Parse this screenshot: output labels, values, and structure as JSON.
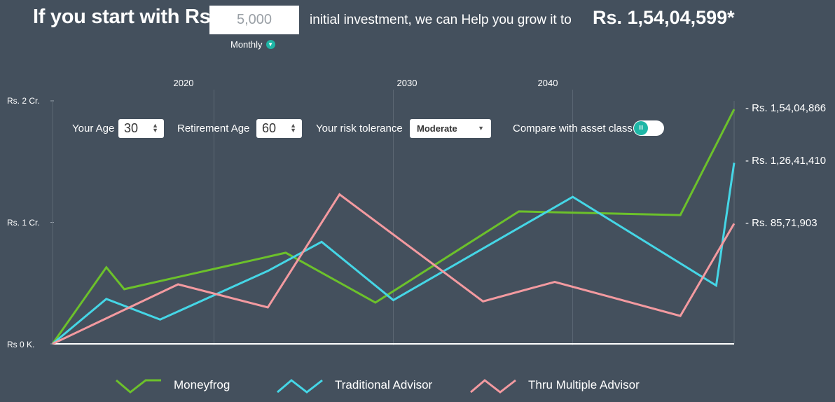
{
  "header": {
    "lead": "If you start with Rs.",
    "amount_value": "5,000",
    "frequency": "Monthly",
    "mid": "initial investment, we can Help you grow it to",
    "result": "Rs. 1,54,04,599*"
  },
  "controls": {
    "age_label": "Your Age",
    "age_value": "30",
    "retirement_label": "Retirement Age",
    "retirement_value": "60",
    "risk_label": "Your risk tolerance",
    "risk_value": "Moderate",
    "compare_label": "Compare with asset class"
  },
  "colors": {
    "background": "#44505d",
    "moneyfrog": "#6cc12b",
    "traditional": "#45d6e6",
    "multiple": "#f39aa0",
    "toggle_accent": "#1fb6a6"
  },
  "chart_data": {
    "type": "line",
    "x_top_ticks": [
      "2020",
      "2030",
      "2040"
    ],
    "y_tick_labels": [
      "Rs. 2 Cr.",
      "Rs. 1 Cr.",
      "Rs 0 K."
    ],
    "ylim": [
      0,
      20000000
    ],
    "right_labels": [
      "- Rs. 1,54,04,866",
      "- Rs. 1,26,41,410",
      "- Rs. 85,71,903"
    ],
    "grid": true,
    "legend_position": "bottom",
    "x": [
      2011,
      2014,
      2015,
      2017,
      2018,
      2021,
      2024,
      2026,
      2029,
      2030,
      2035,
      2037,
      2039,
      2046,
      2048,
      2049
    ],
    "series": [
      {
        "name": "Moneyfrog",
        "color": "#6cc12b",
        "points": [
          [
            2011,
            0
          ],
          [
            2014,
            6300000
          ],
          [
            2015,
            4500000
          ],
          [
            2024,
            7500000
          ],
          [
            2029,
            3400000
          ],
          [
            2037,
            10900000
          ],
          [
            2046,
            10600000
          ],
          [
            2049,
            19300000
          ]
        ]
      },
      {
        "name": "Traditional Advisor",
        "color": "#45d6e6",
        "points": [
          [
            2011,
            0
          ],
          [
            2014,
            3700000
          ],
          [
            2017,
            2000000
          ],
          [
            2023,
            6000000
          ],
          [
            2026,
            8400000
          ],
          [
            2030,
            3600000
          ],
          [
            2040,
            12100000
          ],
          [
            2048,
            4800000
          ],
          [
            2049,
            14900000
          ]
        ]
      },
      {
        "name": "Thru Multiple Advisor",
        "color": "#f39aa0",
        "points": [
          [
            2011,
            0
          ],
          [
            2018,
            4900000
          ],
          [
            2023,
            3000000
          ],
          [
            2027,
            12300000
          ],
          [
            2035,
            3500000
          ],
          [
            2039,
            5100000
          ],
          [
            2046,
            2300000
          ],
          [
            2049,
            9900000
          ]
        ]
      }
    ]
  }
}
